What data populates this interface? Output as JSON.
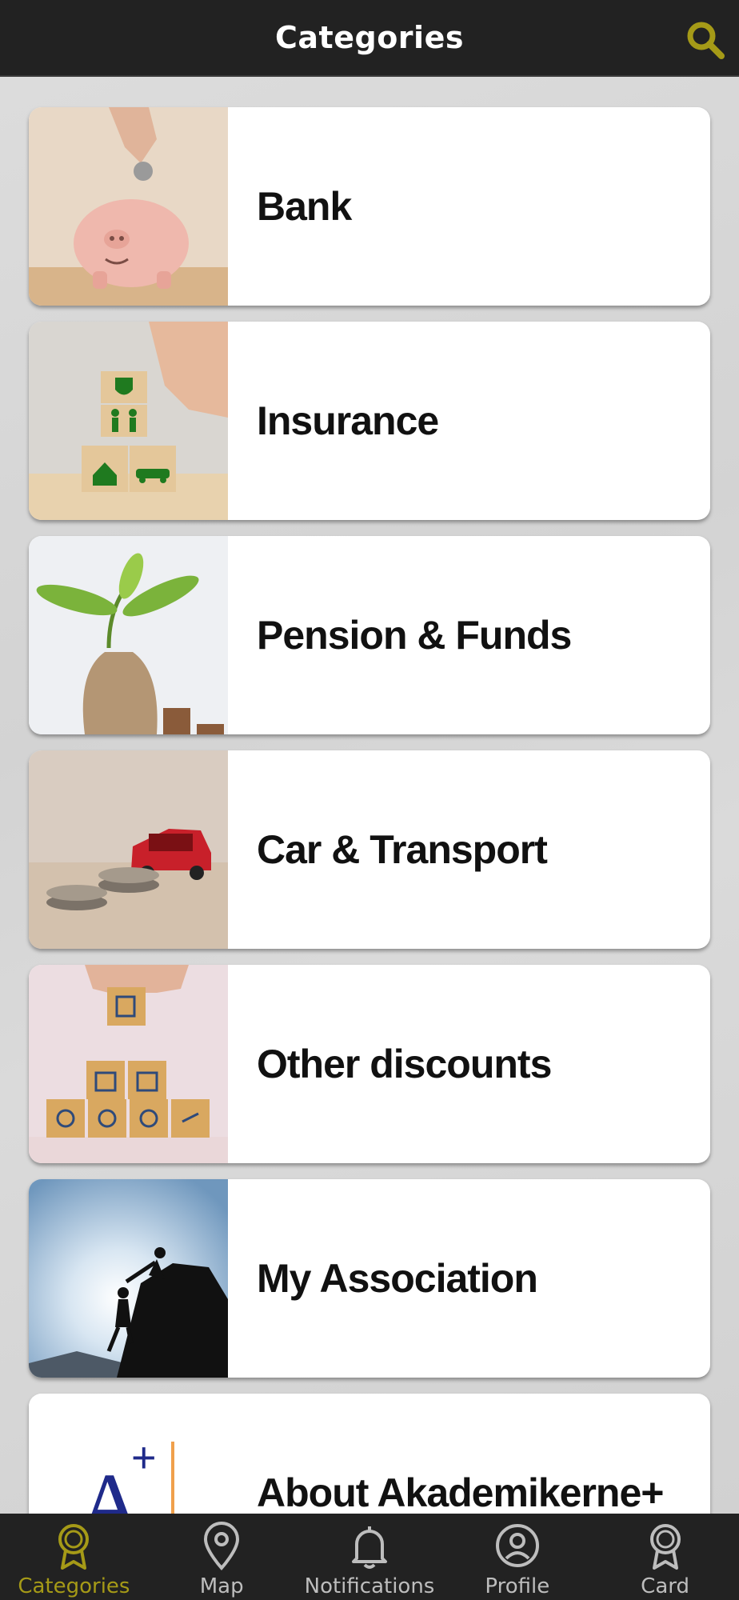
{
  "header": {
    "title": "Categories",
    "search_icon": "search-icon",
    "accent_color": "#a59a17"
  },
  "categories": [
    {
      "label": "Bank",
      "image": "piggy-bank-coin"
    },
    {
      "label": "Insurance",
      "image": "insurance-blocks"
    },
    {
      "label": "Pension & Funds",
      "image": "plant-money-bag"
    },
    {
      "label": "Car & Transport",
      "image": "toy-car-coins"
    },
    {
      "label": "Other discounts",
      "image": "discount-blocks"
    },
    {
      "label": "My Association",
      "image": "climbers-silhouette"
    },
    {
      "label": "About Akademikerne+",
      "image": "akademikerne-logo",
      "logo_text": "A+"
    }
  ],
  "navbar": {
    "items": [
      {
        "label": "Categories",
        "icon": "badge-icon",
        "active": true
      },
      {
        "label": "Map",
        "icon": "map-pin-icon",
        "active": false
      },
      {
        "label": "Notifications",
        "icon": "bell-icon",
        "active": false
      },
      {
        "label": "Profile",
        "icon": "profile-icon",
        "active": false
      },
      {
        "label": "Card",
        "icon": "card-badge-icon",
        "active": false
      }
    ]
  }
}
